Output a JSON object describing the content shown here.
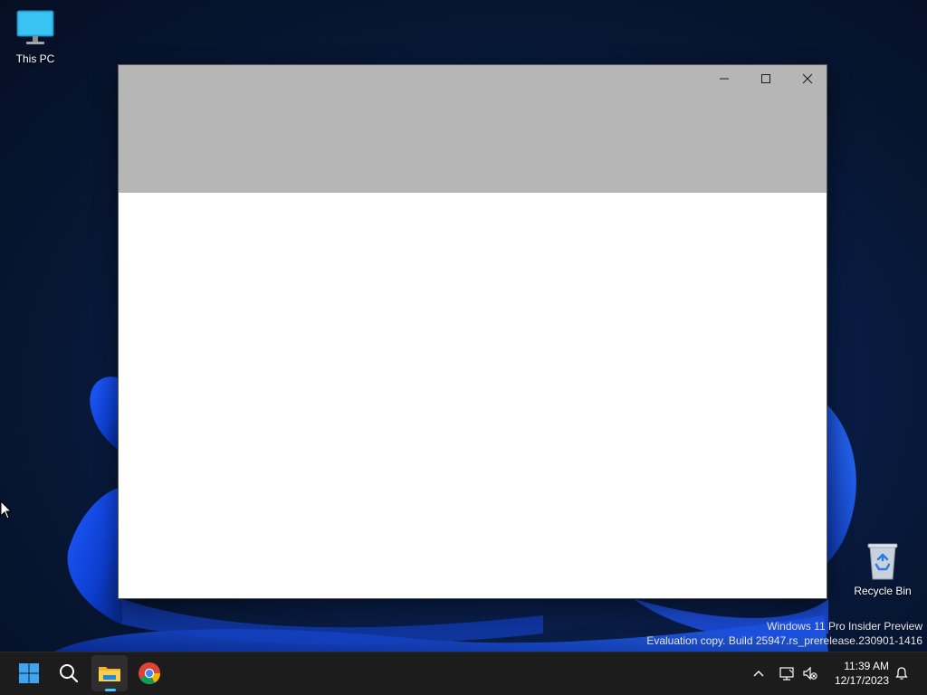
{
  "desktop": {
    "icons": [
      {
        "label": "This PC"
      },
      {
        "label": "Recycle Bin"
      }
    ],
    "watermark": {
      "line1": "Windows 11 Pro Insider Preview",
      "line2": "Evaluation copy. Build 25947.rs_prerelease.230901-1416"
    }
  },
  "window": {
    "title": "",
    "caption_buttons": [
      "minimize-icon",
      "maximize-icon",
      "close-icon"
    ],
    "titlebar_color": "#b6b6b6"
  },
  "taskbar": {
    "pinned": [
      {
        "name": "Start",
        "icon": "windows-logo-icon"
      },
      {
        "name": "Search",
        "icon": "search-icon"
      },
      {
        "name": "File Explorer",
        "icon": "folder-icon",
        "active": true
      },
      {
        "name": "Google Chrome",
        "icon": "chrome-icon"
      }
    ],
    "tray": {
      "icons": [
        "chevron-up-icon",
        "network-icon",
        "volume-muted-icon",
        "bell-icon"
      ],
      "time": "11:39 AM",
      "date": "12/17/2023"
    },
    "accent_color": "#4cc2ff"
  }
}
